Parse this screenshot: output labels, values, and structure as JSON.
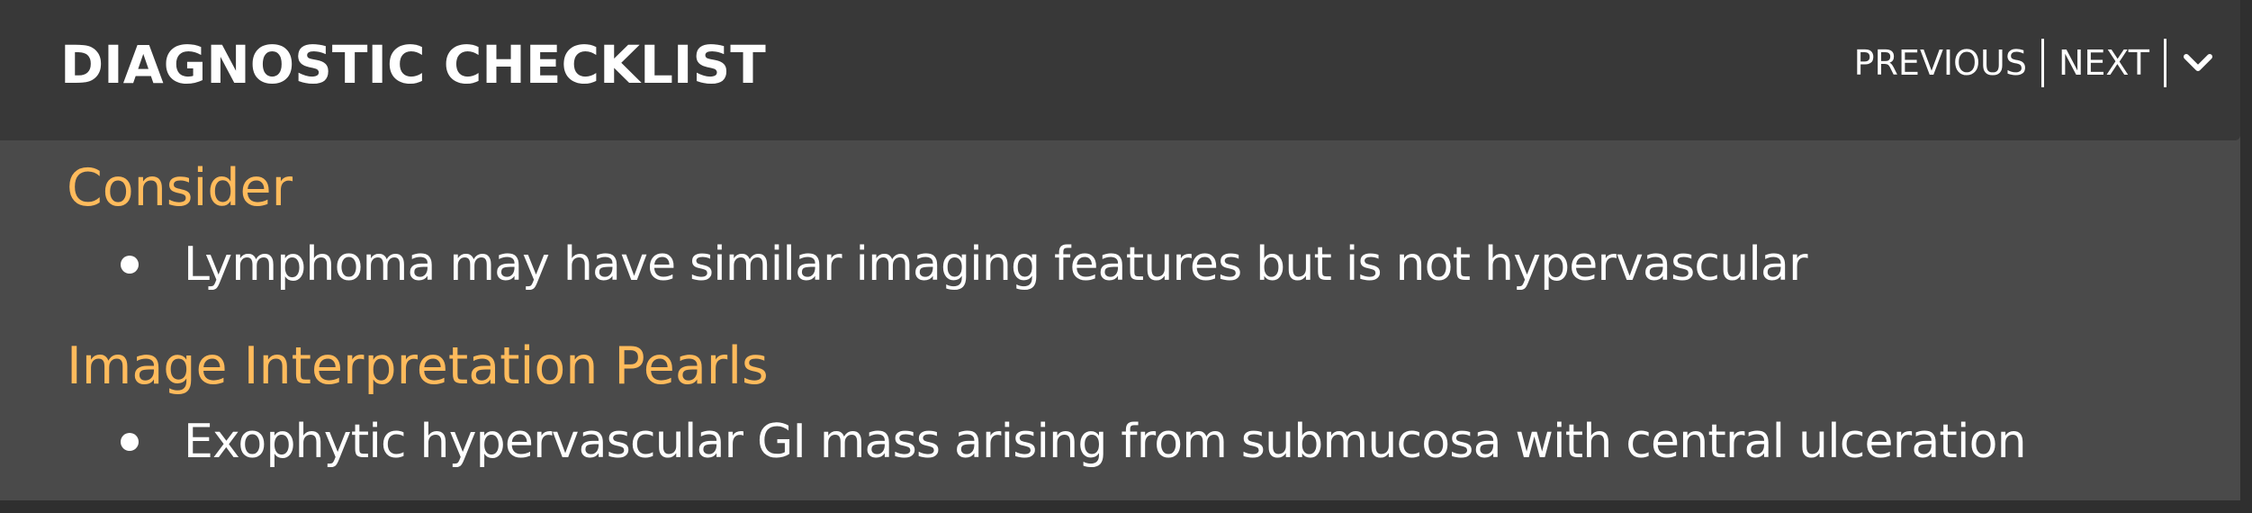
{
  "header": {
    "title": "DIAGNOSTIC CHECKLIST",
    "nav": {
      "previous_label": "PREVIOUS",
      "next_label": "NEXT",
      "toggle_icon": "chevron-down-icon"
    }
  },
  "sections": [
    {
      "heading": "Consider",
      "items": [
        "Lymphoma may have similar imaging features but is not hypervascular"
      ]
    },
    {
      "heading": "Image Interpretation Pearls",
      "items": [
        "Exophytic hypervascular GI mass arising from submucosa with central ulceration"
      ]
    }
  ],
  "colors": {
    "header_bg": "#383838",
    "body_bg": "#4a4a4a",
    "heading_accent": "#ffbb5c",
    "text": "#ffffff"
  }
}
